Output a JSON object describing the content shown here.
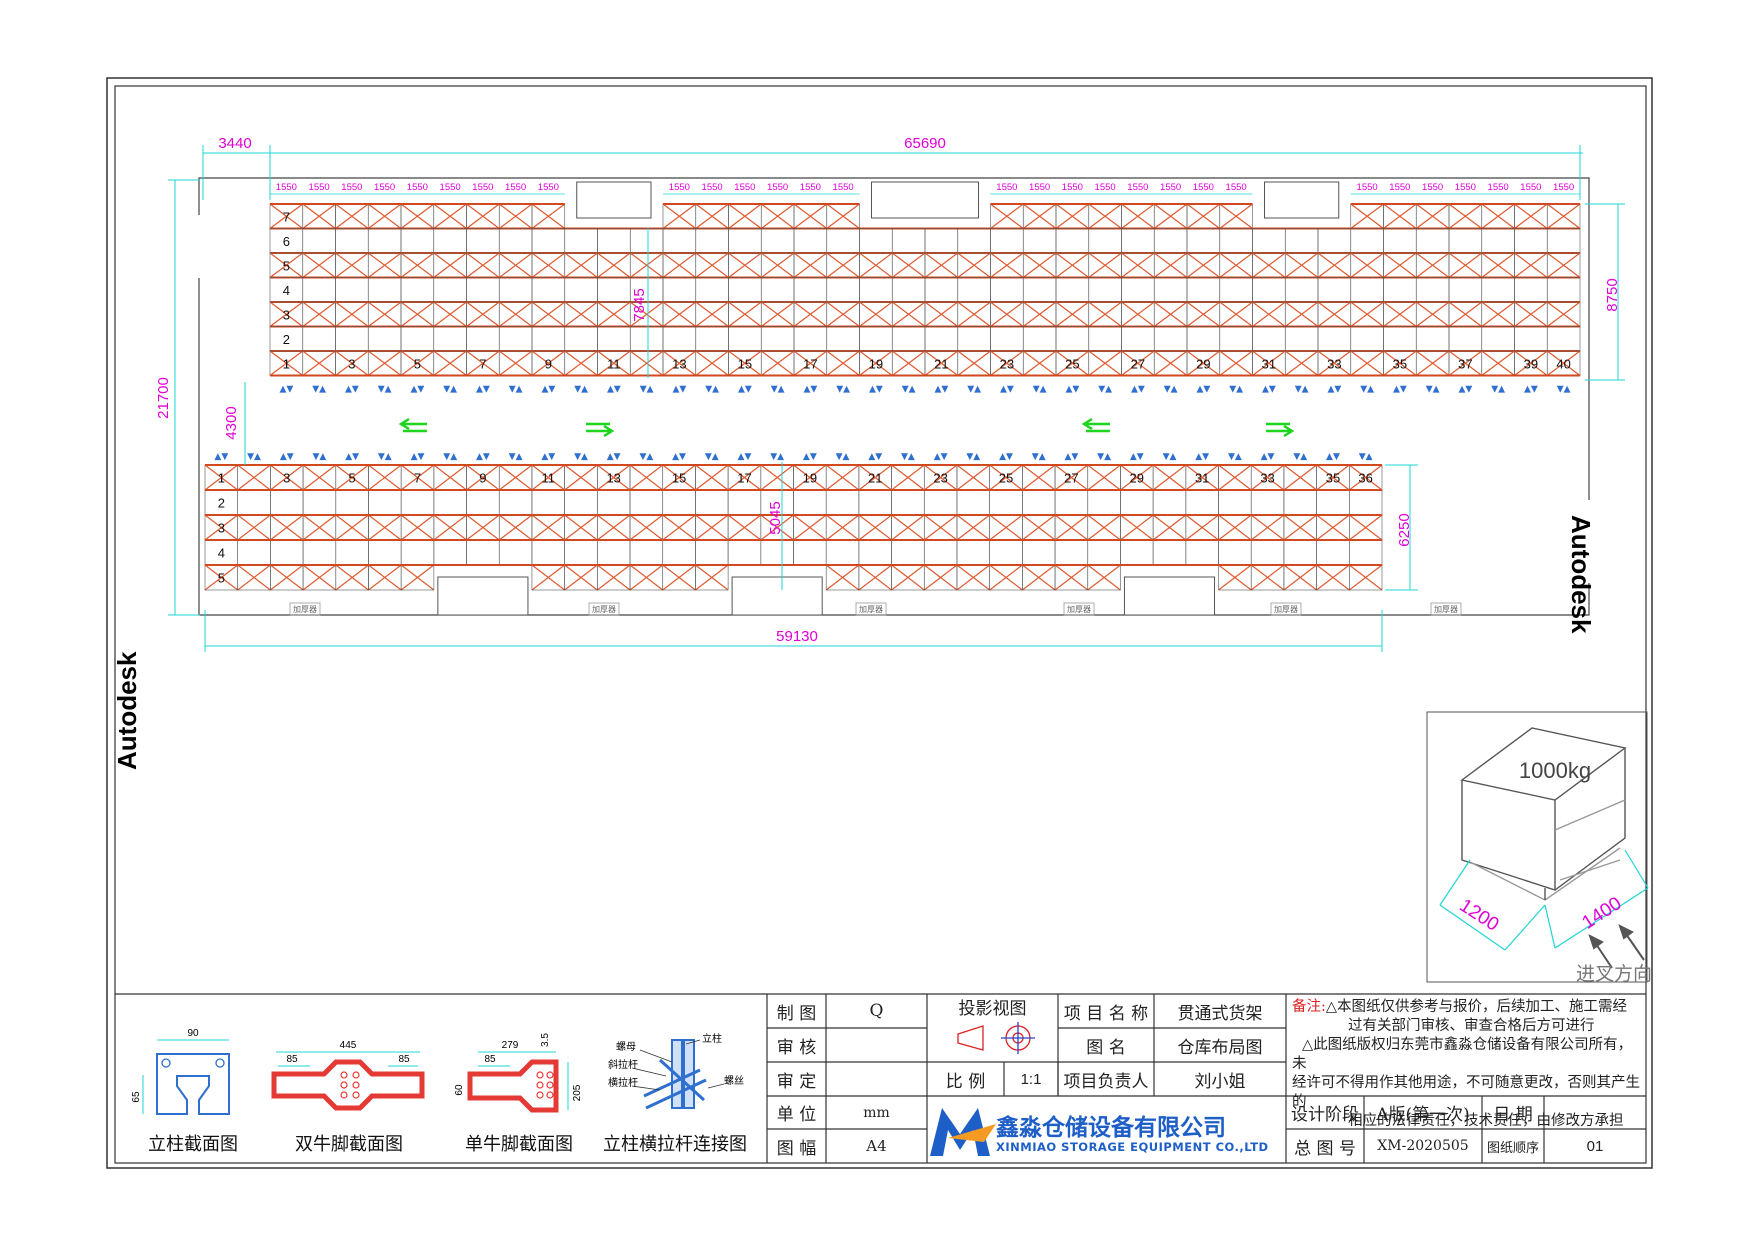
{
  "watermark": "Autodesk",
  "dimensions": {
    "offset_left": "3440",
    "top_total": "65690",
    "bay": "1550",
    "overall_height": "21700",
    "aisle": "4300",
    "upper_block_depth": "8750",
    "upper_inner": "7845",
    "lower_block_depth": "6250",
    "lower_inner": "5045",
    "bottom_total": "59130"
  },
  "upper_block": {
    "row_labels": [
      "7",
      "6",
      "5",
      "4",
      "3",
      "2",
      "1"
    ],
    "bay_labels": [
      "1",
      "3",
      "5",
      "7",
      "9",
      "11",
      "13",
      "15",
      "17",
      "19",
      "21",
      "23",
      "25",
      "27",
      "29",
      "31",
      "33",
      "35",
      "37",
      "39",
      "40"
    ]
  },
  "lower_block": {
    "row_labels": [
      "1",
      "2",
      "3",
      "4",
      "5"
    ],
    "bay_labels": [
      "1",
      "3",
      "5",
      "7",
      "9",
      "11",
      "13",
      "15",
      "17",
      "19",
      "21",
      "23",
      "25",
      "27",
      "29",
      "31",
      "33",
      "35",
      "36"
    ]
  },
  "small_labels": [
    "加厚器",
    "加厚器",
    "加厚器",
    "加厚器",
    "加厚器",
    "加厚器"
  ],
  "pallet": {
    "load": "1000kg",
    "width": "1200",
    "depth": "1400",
    "direction": "进叉方向"
  },
  "sections": [
    {
      "title": "立柱截面图",
      "dims": [
        "90",
        "65"
      ]
    },
    {
      "title": "双牛脚截面图",
      "dims": [
        "445",
        "85",
        "85"
      ]
    },
    {
      "title": "单牛脚截面图",
      "dims": [
        "279",
        "85",
        "3.5",
        "60",
        "205"
      ]
    },
    {
      "title": "立柱横拉杆连接图",
      "parts": [
        "立柱",
        "螺母",
        "斜拉杆",
        "横拉杆",
        "螺丝"
      ]
    }
  ],
  "titleblock": {
    "zhitu": "制 图",
    "zhitu_v": "Q",
    "shenhe": "审 核",
    "shenhe_v": "",
    "shending": "审 定",
    "shending_v": "",
    "danwei": "单 位",
    "danwei_v": "mm",
    "tufu": "图 幅",
    "tufu_v": "A4",
    "touying": "投影视图",
    "bili": "比 例",
    "bili_v": "1:1",
    "xiangmu": "项 目 名 称",
    "xiangmu_v": "贯通式货架",
    "tuming": "图 名",
    "tuming_v": "仓库布局图",
    "fuzeren": "项目负责人",
    "fuzeren_v": "刘小姐",
    "jieduan": "设计阶段",
    "jieduan_v": "A版(第一次)",
    "riqi": "日 期",
    "riqi_v": "",
    "zongtuhao": "总 图 号",
    "zongtuhao_v": "XM-2020505",
    "shunxu": "图纸顺序",
    "shunxu_v": "01",
    "company_cn": "鑫淼仓储设备有限公司",
    "company_en": "XINMIAO STORAGE EQUIPMENT CO.,LTD",
    "logo": "M",
    "note_label": "备注:",
    "note_l1": "△本图纸仅供参考与报价，后续加工、施工需经",
    "note_l2": "过有关部门审核、审查合格后方可进行",
    "note_l3": "△此图纸版权归东莞市鑫淼仓储设备有限公司所有，未",
    "note_l4": "经许可不得用作其他用途，不可随意更改，否则其产生的",
    "note_l5": "相应的法律责任，技术责任，由修改方承担"
  },
  "colors": {
    "rack": "#d2491f",
    "dim": "#1fd4d4",
    "dim_text": "#e000d8",
    "brace": "#e05a30",
    "arrow": "#1cd51c",
    "truss": "#2f6fd0"
  }
}
